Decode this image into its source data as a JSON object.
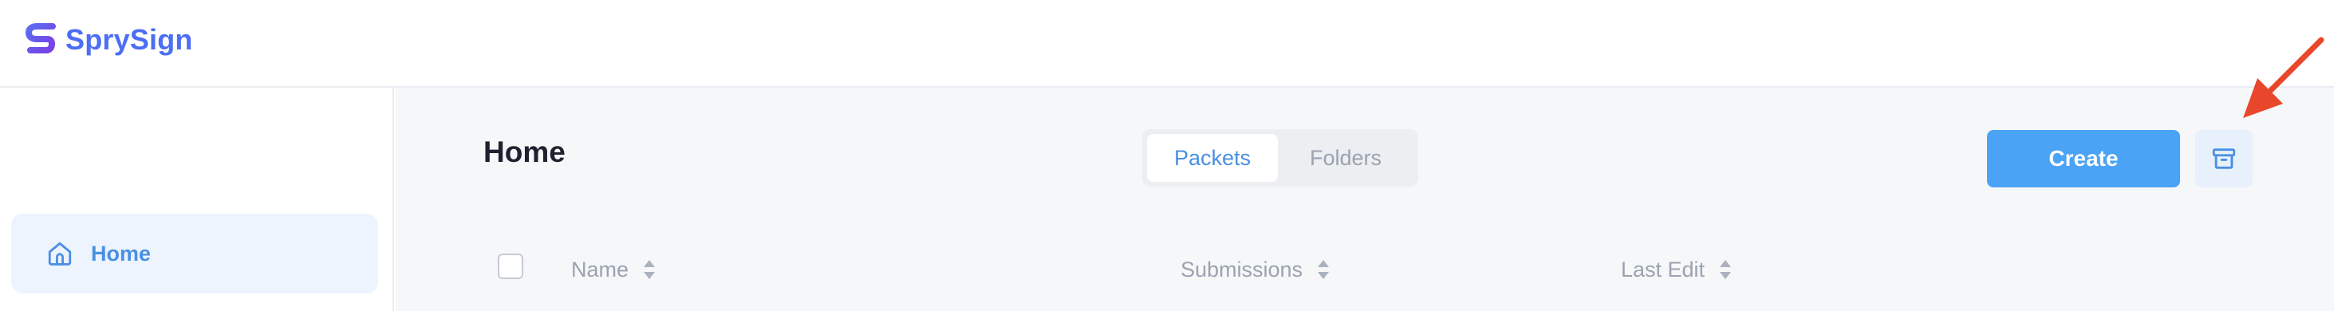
{
  "brand": {
    "name": "SprySign",
    "logo_icon": "sprysign-logo-icon",
    "color": "#4c6ef5"
  },
  "sidebar": {
    "items": [
      {
        "label": "Home",
        "icon": "home-icon",
        "active": true
      }
    ]
  },
  "main": {
    "title": "Home",
    "toggle": {
      "options": [
        "Packets",
        "Folders"
      ],
      "selected": "Packets"
    },
    "create_label": "Create",
    "archive_icon": "archive-icon",
    "table": {
      "columns": [
        "Name",
        "Submissions",
        "Last Edit"
      ]
    }
  },
  "colors": {
    "accent": "#4a90e2",
    "primary_button": "#4ba3f5",
    "annotation": "#e8472b"
  }
}
